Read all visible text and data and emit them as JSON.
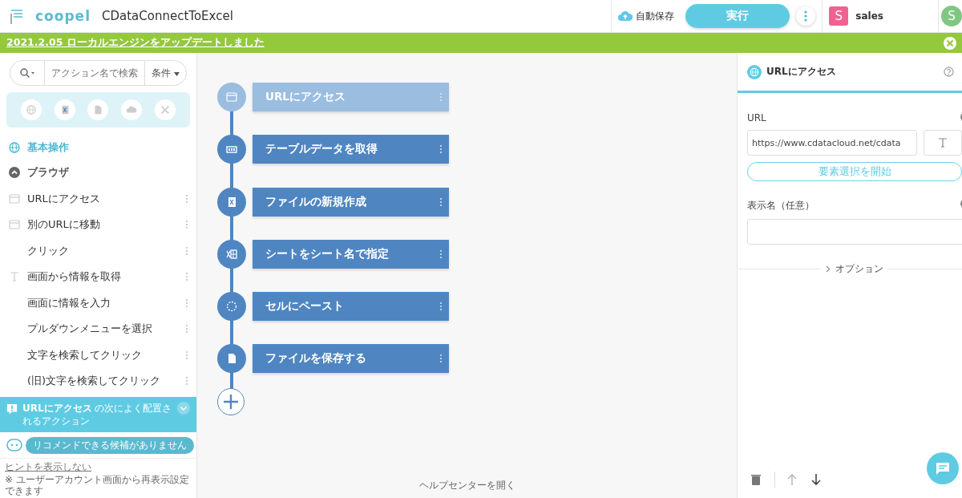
{
  "header": {
    "logo": "coopel",
    "title": "CDataConnectToExcel",
    "autosave": "自動保存",
    "run_button": "実行",
    "user": {
      "initial": "S",
      "name": "sales",
      "color": "#f06292"
    },
    "other_user": {
      "initial": "S",
      "color": "#81c784"
    }
  },
  "banner": {
    "text": "2021.2.05 ローカルエンジンをアップデートしました"
  },
  "sidebar": {
    "search": {
      "placeholder": "アクション名で検索"
    },
    "filter": "条件",
    "categories": [
      {
        "kind": "globe"
      },
      {
        "kind": "excel"
      },
      {
        "kind": "file"
      },
      {
        "kind": "cloud"
      },
      {
        "kind": "tools"
      }
    ],
    "section": "基本操作",
    "group": {
      "label": "ブラウザ",
      "expanded": true
    },
    "items": [
      {
        "label": "URLにアクセス",
        "kind": "browser"
      },
      {
        "label": "別のURLに移動",
        "kind": "browser"
      },
      {
        "label": "クリック",
        "kind": "none"
      },
      {
        "label": "画面から情報を取得",
        "kind": "text"
      },
      {
        "label": "画面に情報を入力",
        "kind": "none"
      },
      {
        "label": "プルダウンメニューを選択",
        "kind": "none"
      },
      {
        "label": "文字を検索してクリック",
        "kind": "none"
      },
      {
        "label": "(旧)文字を検索してクリック",
        "kind": "none"
      }
    ],
    "hint": {
      "title": "**URLにアクセス** の次によく配置されるアクション",
      "message": "リコメンドできる候補がありません",
      "dismiss": "ヒントを表示しない",
      "note": "※ ユーザーアカウント画面から再表示設定できます"
    }
  },
  "flow": {
    "steps": [
      {
        "label": "URLにアクセス",
        "kind": "browser",
        "selected": true
      },
      {
        "label": "テーブルデータを取得",
        "kind": "table",
        "selected": false
      },
      {
        "label": "ファイルの新規作成",
        "kind": "excel",
        "selected": false
      },
      {
        "label": "シートをシート名で指定",
        "kind": "sheet",
        "selected": false
      },
      {
        "label": "セルにペースト",
        "kind": "cell",
        "selected": false
      },
      {
        "label": "ファイルを保存する",
        "kind": "file",
        "selected": false
      }
    ],
    "help_link": "ヘルプセンターを開く"
  },
  "panel": {
    "title": "URLにアクセス",
    "url_label": "URL",
    "url_value": "https://www.cdatacloud.net/cdata",
    "select_button": "要素選択を開始",
    "name_label": "表示名（任意）",
    "options": "オプション"
  }
}
